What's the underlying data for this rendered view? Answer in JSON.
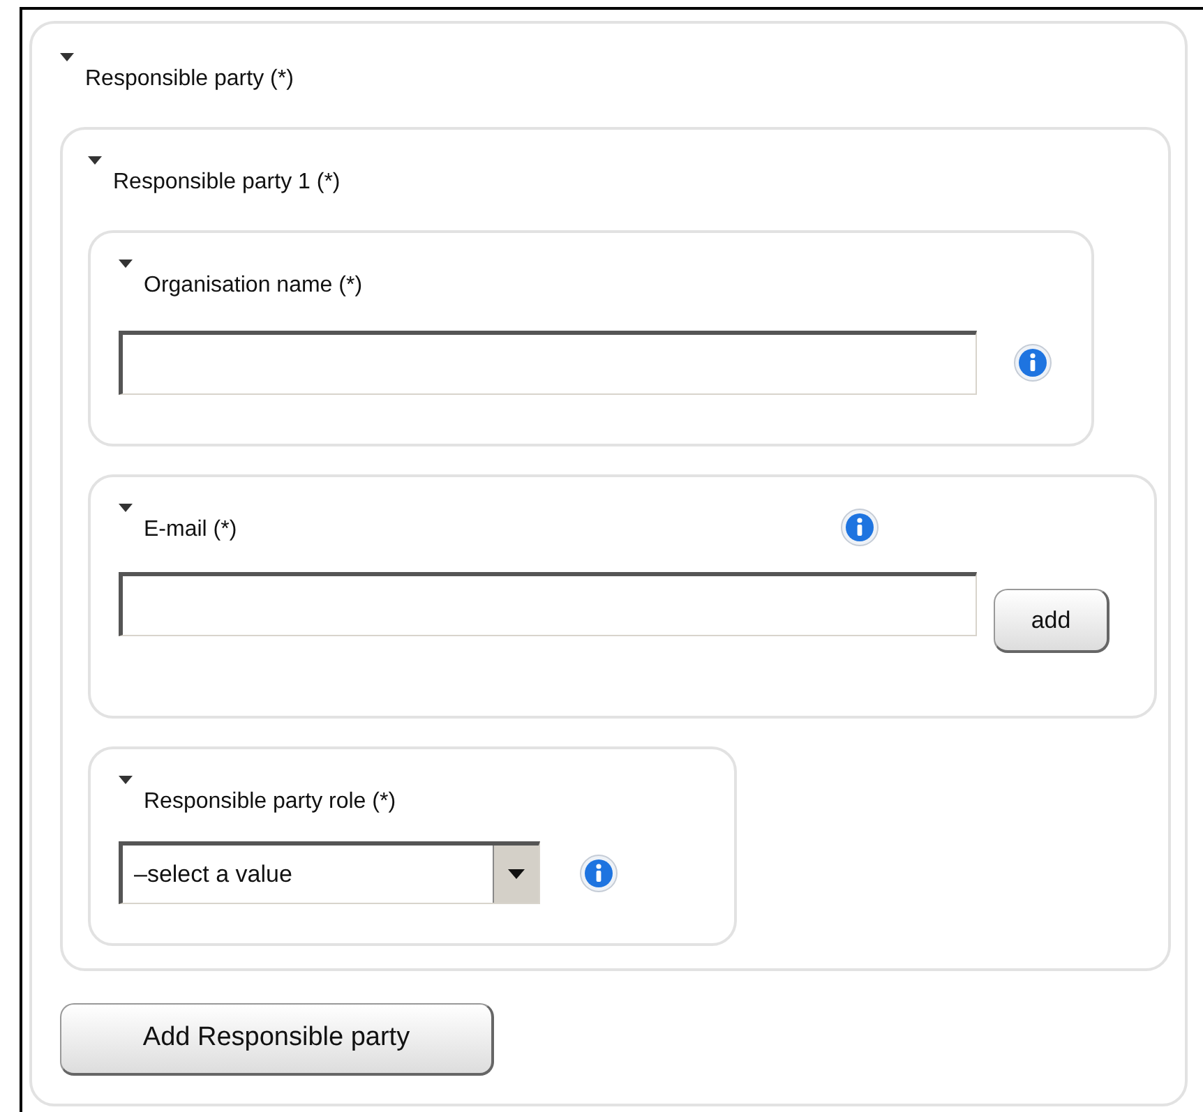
{
  "section": {
    "title": "Responsible party (*)",
    "expanded": true,
    "party": {
      "title": "Responsible party 1 (*)",
      "expanded": true,
      "fields": [
        {
          "kind": "text",
          "label": "Organisation name (*)",
          "expanded": true
        },
        {
          "kind": "multi",
          "label": "E-mail (*)",
          "expanded": true,
          "button": "add"
        },
        {
          "kind": "select",
          "label": "Responsible party role (*)",
          "expanded": true,
          "value": "–select a value"
        }
      ]
    },
    "add_button": "Add Responsible party"
  }
}
